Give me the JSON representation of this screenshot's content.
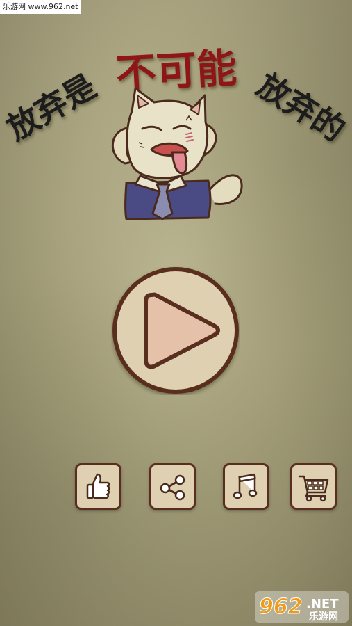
{
  "watermark": {
    "top_text": "乐游网 www.962.net",
    "logo_number": "962",
    "logo_suffix": ".NET",
    "logo_sub": "乐游网"
  },
  "title": {
    "left": "放弃是",
    "middle": "不可能",
    "right": "放弃的"
  },
  "buttons": {
    "play": "play-icon",
    "like": "thumbs-up-icon",
    "share": "share-icon",
    "music": "music-note-icon",
    "shop": "shopping-cart-icon"
  },
  "colors": {
    "title_dark": "#1b1b1b",
    "title_red": "#8e1416",
    "button_fill": "#ded0b1",
    "button_border": "#5a2e1e",
    "play_triangle": "#e6c1a9"
  }
}
